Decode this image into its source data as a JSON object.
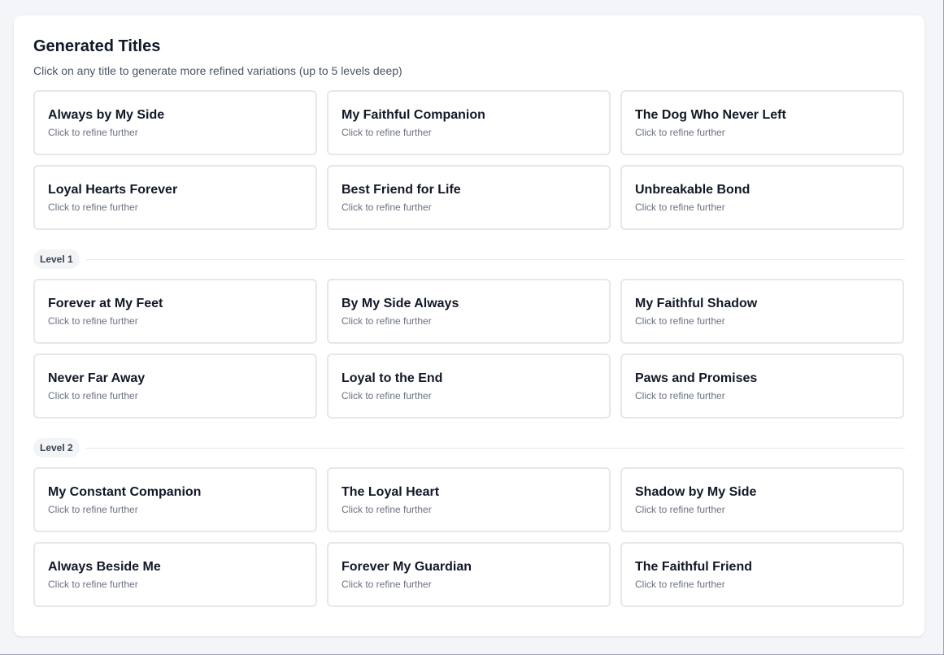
{
  "panel": {
    "title": "Generated Titles",
    "subtitle": "Click on any title to generate more refined variations (up to 5 levels deep)"
  },
  "groups": [
    {
      "label": "",
      "cards": [
        {
          "title": "Always by My Side",
          "hint": "Click to refine further"
        },
        {
          "title": "My Faithful Companion",
          "hint": "Click to refine further"
        },
        {
          "title": "The Dog Who Never Left",
          "hint": "Click to refine further"
        },
        {
          "title": "Loyal Hearts Forever",
          "hint": "Click to refine further"
        },
        {
          "title": "Best Friend for Life",
          "hint": "Click to refine further"
        },
        {
          "title": "Unbreakable Bond",
          "hint": "Click to refine further"
        }
      ]
    },
    {
      "label": "Level 1",
      "cards": [
        {
          "title": "Forever at My Feet",
          "hint": "Click to refine further"
        },
        {
          "title": "By My Side Always",
          "hint": "Click to refine further"
        },
        {
          "title": "My Faithful Shadow",
          "hint": "Click to refine further"
        },
        {
          "title": "Never Far Away",
          "hint": "Click to refine further"
        },
        {
          "title": "Loyal to the End",
          "hint": "Click to refine further"
        },
        {
          "title": "Paws and Promises",
          "hint": "Click to refine further"
        }
      ]
    },
    {
      "label": "Level 2",
      "cards": [
        {
          "title": "My Constant Companion",
          "hint": "Click to refine further"
        },
        {
          "title": "The Loyal Heart",
          "hint": "Click to refine further"
        },
        {
          "title": "Shadow by My Side",
          "hint": "Click to refine further"
        },
        {
          "title": "Always Beside Me",
          "hint": "Click to refine further"
        },
        {
          "title": "Forever My Guardian",
          "hint": "Click to refine further"
        },
        {
          "title": "The Faithful Friend",
          "hint": "Click to refine further"
        }
      ]
    }
  ]
}
